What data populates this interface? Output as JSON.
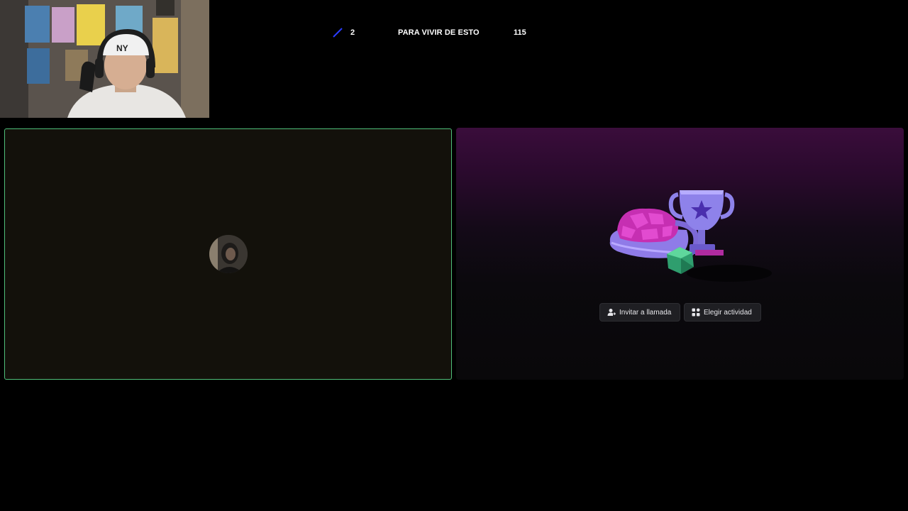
{
  "stream_stats": {
    "count": "2",
    "title": "PARA VIVIR DE ESTO",
    "number": "115",
    "accent_color": "#2a3cff"
  },
  "call": {
    "active_border_color": "#4fbf7a",
    "actions": {
      "invite_label": "Invitar a llamada",
      "activity_label": "Elegir actividad"
    }
  },
  "icons": [
    "add-user-icon",
    "activity-grid-icon"
  ]
}
